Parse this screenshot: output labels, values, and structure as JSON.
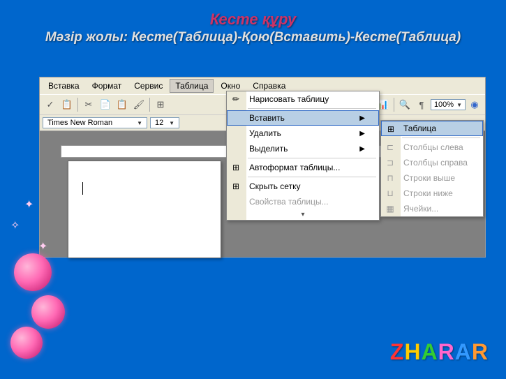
{
  "slide": {
    "title": "Кесте құру",
    "subtitle": "Мәзір жолы: Кесте(Таблица)-Қою(Вставить)-Кесте(Таблица)"
  },
  "menubar": {
    "items": [
      "Вставка",
      "Формат",
      "Сервис",
      "Таблица",
      "Окно",
      "Справка"
    ]
  },
  "toolbar": {
    "zoom": "100%"
  },
  "format_bar": {
    "font": "Times New Roman",
    "size": "12"
  },
  "table_menu": {
    "draw": "Нарисовать таблицу",
    "insert": "Вставить",
    "delete": "Удалить",
    "select": "Выделить",
    "autoformat": "Автоформат таблицы...",
    "hide_grid": "Скрыть сетку",
    "properties": "Свойства таблицы..."
  },
  "insert_submenu": {
    "table": "Таблица",
    "cols_left": "Столбцы слева",
    "cols_right": "Столбцы справа",
    "rows_above": "Строки выше",
    "rows_below": "Строки ниже",
    "cells": "Ячейки..."
  },
  "logo": {
    "letters": [
      "Z",
      "H",
      "A",
      "R",
      "A",
      "R"
    ],
    "colors": [
      "#ff3333",
      "#ffcc00",
      "#33cc33",
      "#ff66cc",
      "#3399ff",
      "#ff9933"
    ]
  }
}
